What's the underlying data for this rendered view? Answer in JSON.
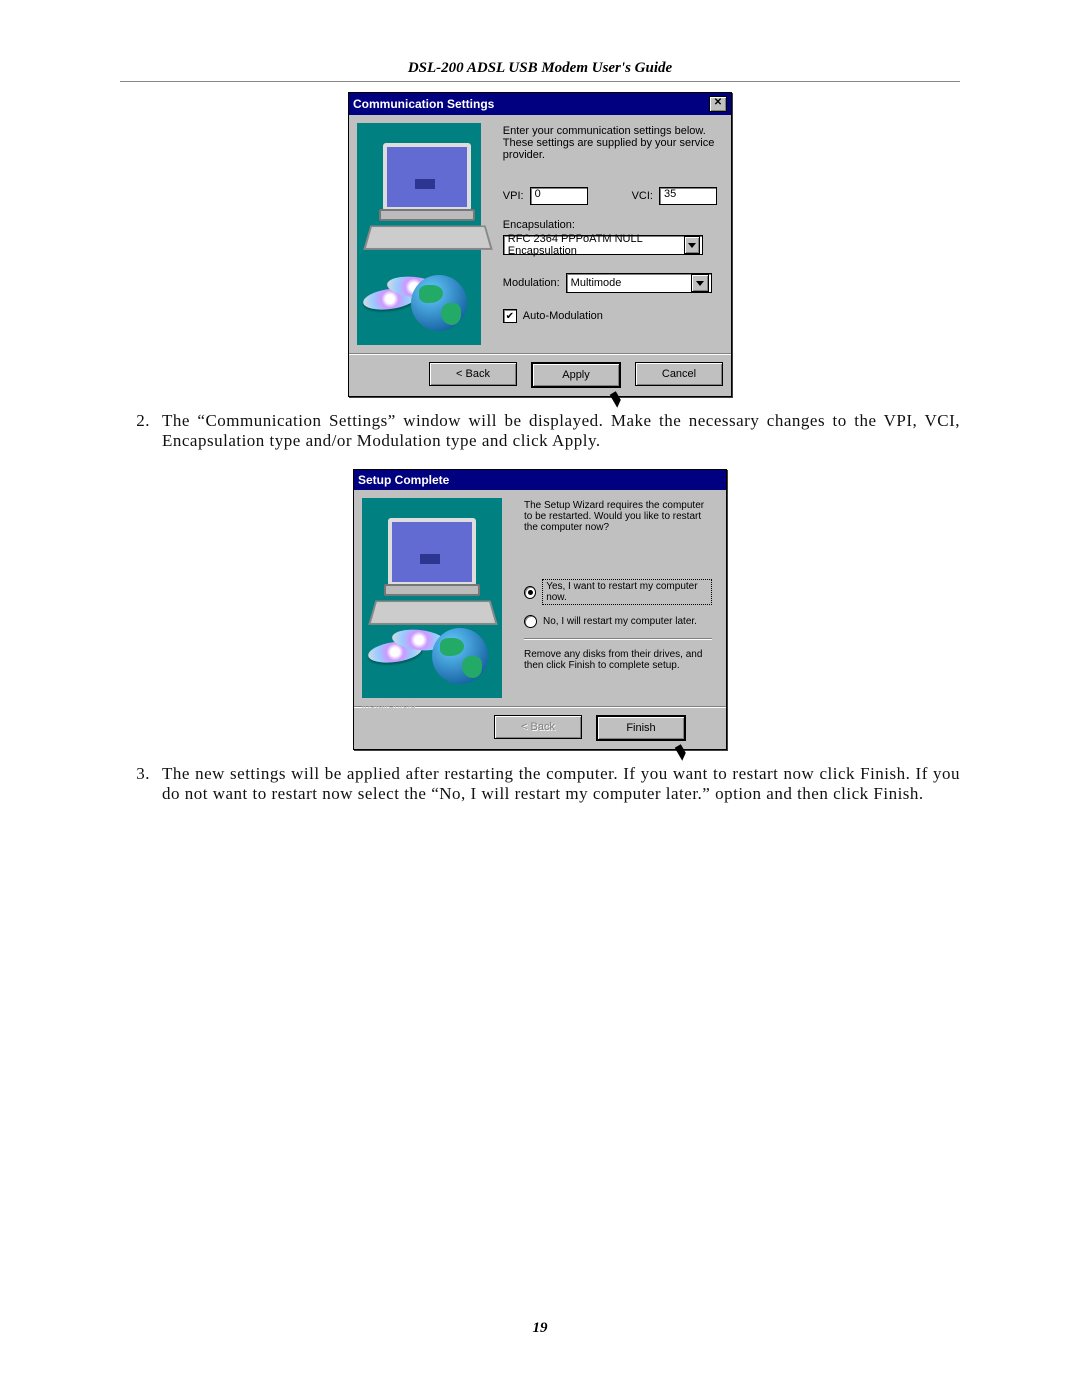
{
  "header": "DSL-200 ADSL USB Modem User's Guide",
  "page_number": "19",
  "dlg1": {
    "title": "Communication Settings",
    "close": "✕",
    "intro": "Enter your communication settings below.  These settings are supplied by your service provider.",
    "vpi_label": "VPI:",
    "vpi_value": "0",
    "vci_label": "VCI:",
    "vci_value": "35",
    "encap_label": "Encapsulation:",
    "encap_value": "RFC 2364 PPPoATM NULL Encapsulation",
    "mod_label": "Modulation:",
    "mod_value": "Multimode",
    "automod_label": "Auto-Modulation",
    "back": "< Back",
    "apply": "Apply",
    "cancel": "Cancel"
  },
  "step2": {
    "num": "2.",
    "text": "The “Communication Settings” window will be displayed. Make the necessary changes to the VPI, VCI, Encapsulation type and/or Modulation type and click Apply."
  },
  "dlg2": {
    "title": "Setup Complete",
    "intro": "The Setup Wizard requires the computer to be restarted.  Would you like to restart the computer now?",
    "opt_yes": "Yes, I want to restart my computer now.",
    "opt_no": "No, I will restart my computer later.",
    "outro": "Remove any disks from their drives, and then click Finish to complete setup.",
    "brand": "InstallShield",
    "back": "< Back",
    "finish": "Finish"
  },
  "step3": {
    "num": "3.",
    "text": "The new settings will be applied after restarting the computer. If you want to restart now click Finish. If you do not want to restart now select the “No, I will restart my computer later.” option and then click Finish."
  }
}
